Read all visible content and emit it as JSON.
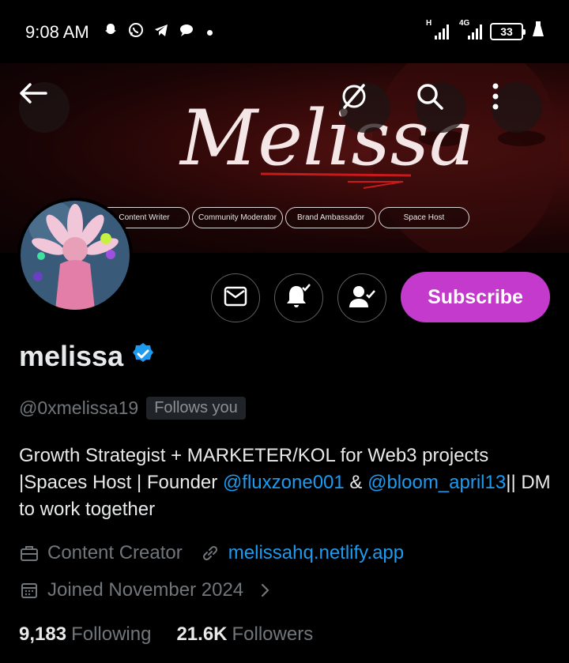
{
  "status_bar": {
    "time": "9:08 AM",
    "network_h": "H",
    "network_4g": "4G",
    "battery": "33"
  },
  "banner": {
    "title": "Melissa",
    "pills": [
      "Content Writer",
      "Community Moderator",
      "Brand Ambassador",
      "Space Host"
    ]
  },
  "actions": {
    "subscribe_label": "Subscribe"
  },
  "profile": {
    "display_name": "melissa",
    "handle": "@0xmelissa19",
    "follows_you": "Follows you",
    "bio_part1": "Growth Strategist + MARKETER/KOL for Web3 projects  |Spaces Host | Founder ",
    "bio_link1": "@fluxzone001",
    "bio_part2": " & ",
    "bio_link2": "@bloom_april13",
    "bio_part3": "|| DM to work together",
    "category": "Content Creator",
    "website": "melissahq.netlify.app",
    "joined": "Joined November 2024",
    "following_count": "9,183",
    "following_label": "Following",
    "followers_count": "21.6K",
    "followers_label": "Followers"
  },
  "colors": {
    "accent_link": "#1d9bf0",
    "subscribe_bg": "#c43acc",
    "verified": "#1d9bf0"
  }
}
